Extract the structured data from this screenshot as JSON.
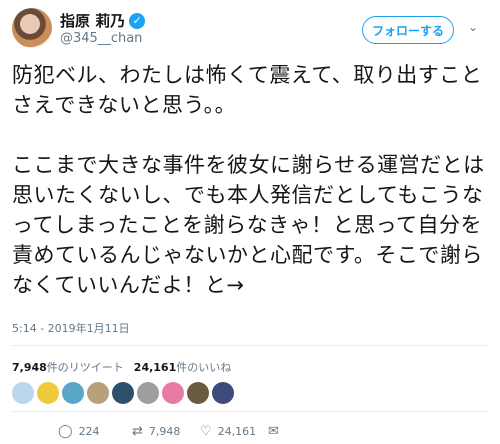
{
  "user": {
    "display_name": "指原 莉乃",
    "handle": "@345__chan",
    "verified_mark": "✓",
    "follow_label": "フォローする",
    "menu_icon": "⌄"
  },
  "tweet": {
    "text": "防犯ベル、わたしは怖くて震えて、取り出すことさえできないと思う。。\n\nここまで大きな事件を彼女に謝らせる運営だとは思いたくないし、でも本人発信だとしてもこうなってしまったことを謝らなきゃ！と思って自分を責めているんじゃないかと心配です。そこで謝らなくていいんだよ！と→",
    "timestamp": "5:14 - 2019年1月11日"
  },
  "stats": {
    "retweets_count": "7,948",
    "retweets_label": "件のリツイート",
    "likes_count": "24,161",
    "likes_label": "件のいいね"
  },
  "likers": [
    {
      "color": "#b9d7ee"
    },
    {
      "color": "#f0c93d"
    },
    {
      "color": "#5aa6c8"
    },
    {
      "color": "#b8a07c"
    },
    {
      "color": "#2f4f6f"
    },
    {
      "color": "#9e9e9e"
    },
    {
      "color": "#e87aa5"
    },
    {
      "color": "#6b5b3e"
    },
    {
      "color": "#3d4a7a"
    }
  ],
  "actions": {
    "reply_icon": "◯",
    "reply_count": "224",
    "retweet_icon": "⇄",
    "retweet_count": "7,948",
    "like_icon": "♡",
    "like_count": "24,161",
    "dm_icon": "✉"
  },
  "colors": {
    "accent": "#1da1f2",
    "muted": "#657786",
    "text": "#14171a"
  }
}
